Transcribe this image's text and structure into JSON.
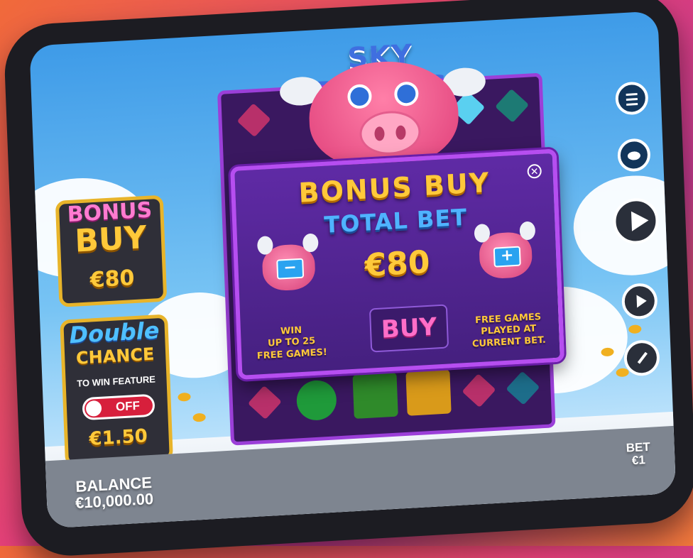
{
  "game": {
    "logo_text": "SKY PIGGIES"
  },
  "bonus_buy_panel": {
    "title_line1": "BONUS",
    "title_line2": "BUY",
    "price": "€80"
  },
  "double_chance_panel": {
    "title_line1": "Double",
    "title_line2": "CHANCE",
    "subtitle": "TO WIN FEATURE",
    "toggle_state": "OFF",
    "price": "€1.50"
  },
  "modal": {
    "title": "BONUS BUY",
    "subtitle": "TOTAL BET",
    "price": "€80",
    "buy_label": "BUY",
    "left_text": "WIN\nUP TO 25\nFREE GAMES!",
    "right_text": "FREE GAMES\nPLAYED AT\nCURRENT BET.",
    "close_symbol": "✕",
    "minus_symbol": "−",
    "plus_symbol": "+"
  },
  "footer": {
    "balance_label": "BALANCE",
    "balance_value": "€10,000.00",
    "bet_label": "BET",
    "bet_value": "€1"
  },
  "controls": {
    "menu_icon": "menu-icon",
    "bet_icon": "coin-stack-icon",
    "spin_icon": "play-icon",
    "autoplay_icon": "autoplay-icon",
    "turbo_icon": "speedometer-icon"
  },
  "colors": {
    "gold": "#ffc93a",
    "modal_purple": "#5f2aa5",
    "modal_border": "#b64ef0",
    "buy_pink": "#ff6ec8",
    "total_bet_blue": "#4fb3ff",
    "toggle_red": "#d71f3c"
  }
}
